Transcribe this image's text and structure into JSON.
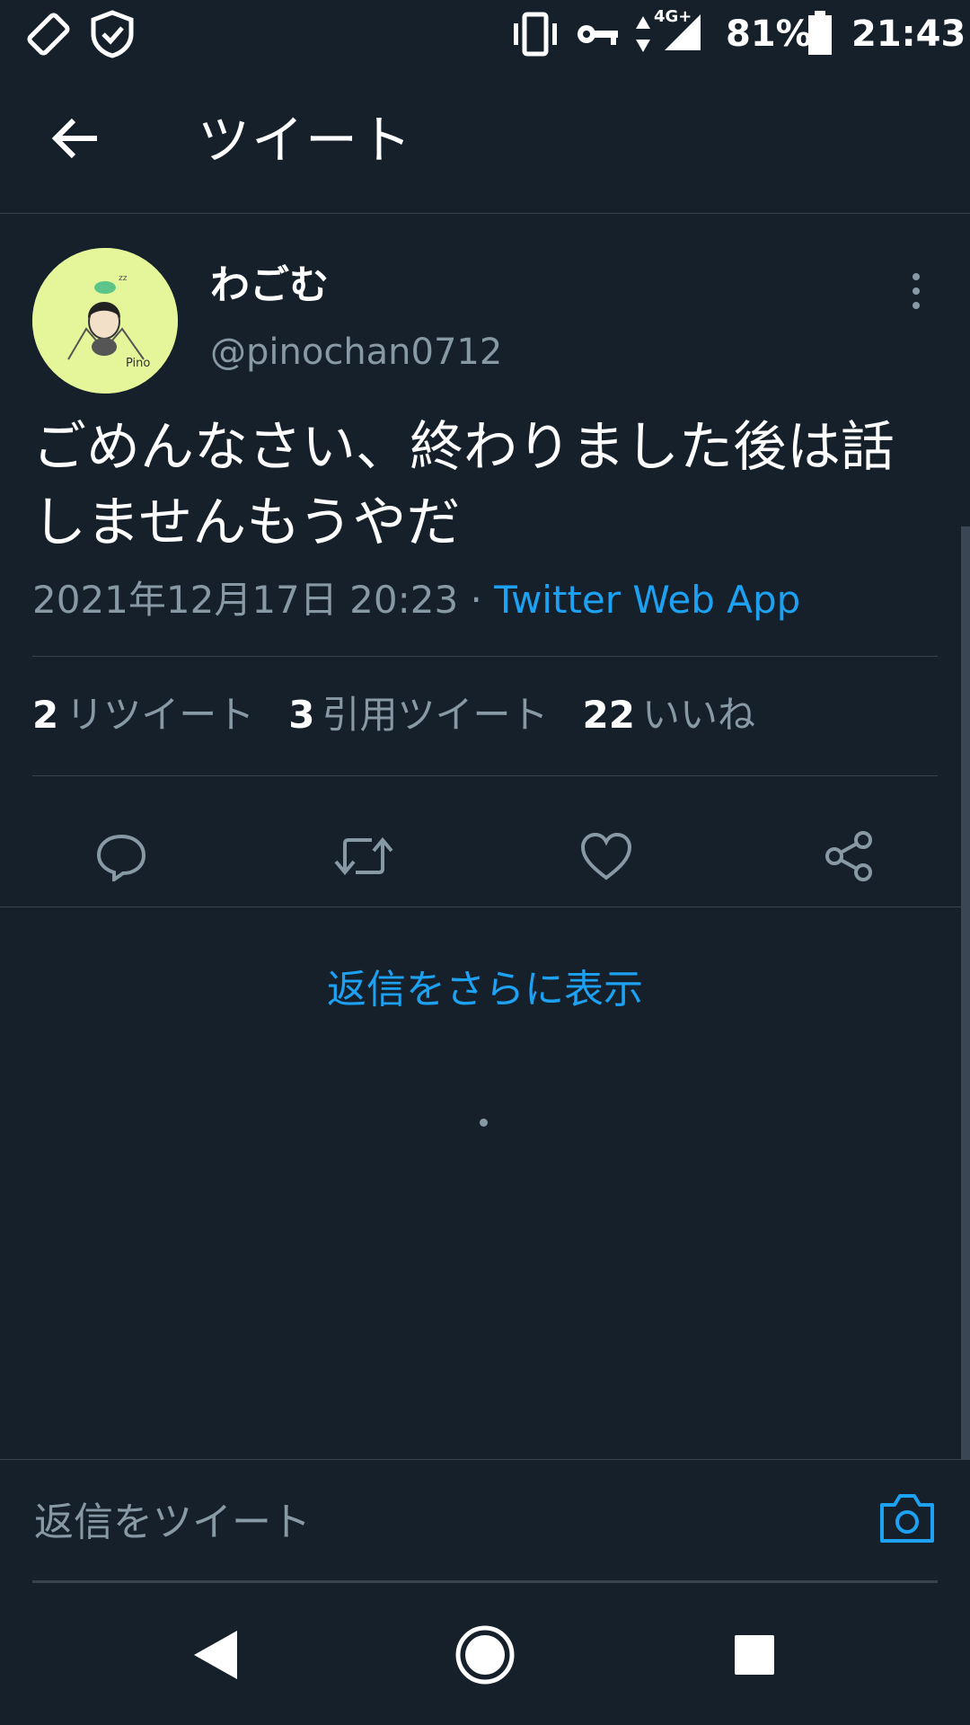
{
  "status_bar": {
    "battery": "81%",
    "time": "21:43",
    "network": "4G+",
    "icons": [
      "screen-rotate-icon",
      "shield-check-icon",
      "vibrate-icon",
      "vpn-key-icon",
      "data-arrows-icon",
      "signal-icon",
      "battery-icon"
    ]
  },
  "header": {
    "title": "ツイート",
    "back_icon": "arrow-left-icon"
  },
  "tweet": {
    "display_name": "わごむ",
    "handle": "@pinochan0712",
    "text": "ごめんなさい、終わりました後は話しませんもうやだ",
    "timestamp": "2021年12月17日 20:23",
    "separator": " · ",
    "source": "Twitter Web App",
    "avatar_label": "Pino",
    "more_icon": "more-vertical-icon"
  },
  "stats": {
    "retweets": {
      "count": "2",
      "label": "リツイート"
    },
    "quotes": {
      "count": "3",
      "label": "引用ツイート"
    },
    "likes": {
      "count": "22",
      "label": "いいね"
    }
  },
  "actions": [
    {
      "name": "reply",
      "icon": "reply-icon"
    },
    {
      "name": "retweet",
      "icon": "retweet-icon"
    },
    {
      "name": "like",
      "icon": "heart-icon"
    },
    {
      "name": "share",
      "icon": "share-icon"
    }
  ],
  "more_replies": "返信をさらに表示",
  "reply_bar": {
    "placeholder": "返信をツイート",
    "camera_icon": "camera-icon"
  },
  "nav": {
    "icons": [
      "back-triangle-icon",
      "home-circle-icon",
      "recents-square-icon"
    ]
  },
  "colors": {
    "background": "#15202b",
    "accent": "#1da1f2",
    "secondary_text": "#8899a6",
    "divider": "#38444d",
    "avatar_bg": "#e5f59a"
  }
}
